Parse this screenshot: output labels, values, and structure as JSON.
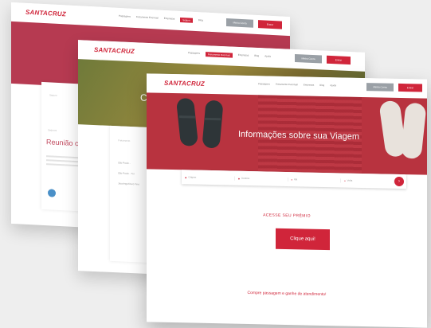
{
  "brand": {
    "logo_text": "SANTACRUZ",
    "accent_color": "#d0253a"
  },
  "back_screen": {
    "nav_links": [
      "Passagens",
      "Fretamento Eventual",
      "Empresas",
      "Seguro",
      "Blog"
    ],
    "active_nav": "Seguro",
    "gray_button": "Minha Conta",
    "red_button": "Entrar",
    "breadcrumb": "Seguro",
    "section_label": "Seguros",
    "heading": "Reunião c"
  },
  "middle_screen": {
    "nav_links": [
      "Passagens",
      "Fretamento Eventual",
      "Empresas",
      "Blog",
      "Ajuda"
    ],
    "active_nav": "Fretamento Eventual",
    "gray_button": "Minha Conta",
    "red_button": "Entrar",
    "hero_letter": "C",
    "breadcrumb": "Fretamento",
    "bullets": [
      "São Paulo - ",
      "São Paulo - Tur",
      "Jacutinga/Ouro Fino"
    ]
  },
  "front_screen": {
    "nav_links": [
      "Passagens",
      "Fretamento Eventual",
      "Empresas",
      "Blog",
      "Ajuda"
    ],
    "gray_button": "Minha Conta",
    "red_button": "Entrar",
    "hero_title": "Informações sobre sua Viagem",
    "search_fields": [
      "Origem",
      "Destino",
      "Ida",
      "Volta"
    ],
    "access_label": "ACESSE SEU PRÊMIO",
    "cta_label": "Clique aqui!",
    "footer_link": "Compre passagem e ganhe de atendimento!"
  }
}
